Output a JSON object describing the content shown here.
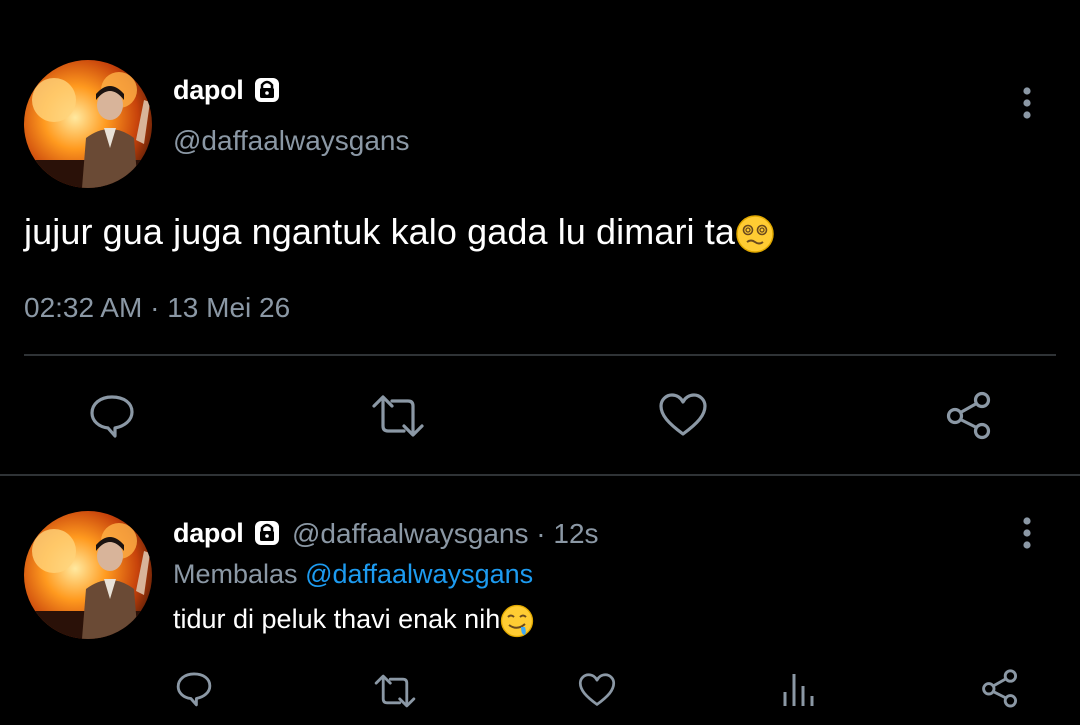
{
  "main_tweet": {
    "author_name": "dapol",
    "author_handle": "@daffaalwaysgans",
    "text": "jujur gua juga ngantuk kalo gada lu dimari ta",
    "time": "02:32 AM",
    "separator": "·",
    "date": "13 Mei 26",
    "emoji": "woozy-face"
  },
  "reply_tweet": {
    "author_name": "dapol",
    "author_handle": "@daffaalwaysgans",
    "dot": "·",
    "age": "12s",
    "replying_prefix": "Membalas",
    "replying_to": "@daffaalwaysgans",
    "text": "tidur di peluk thavi enak nih",
    "emoji": "drooling-face"
  },
  "colors": {
    "background": "#000000",
    "primary_text": "#ffffff",
    "secondary_text": "#8b98a5",
    "accent": "#1d9bf0",
    "divider": "#2f3336"
  }
}
